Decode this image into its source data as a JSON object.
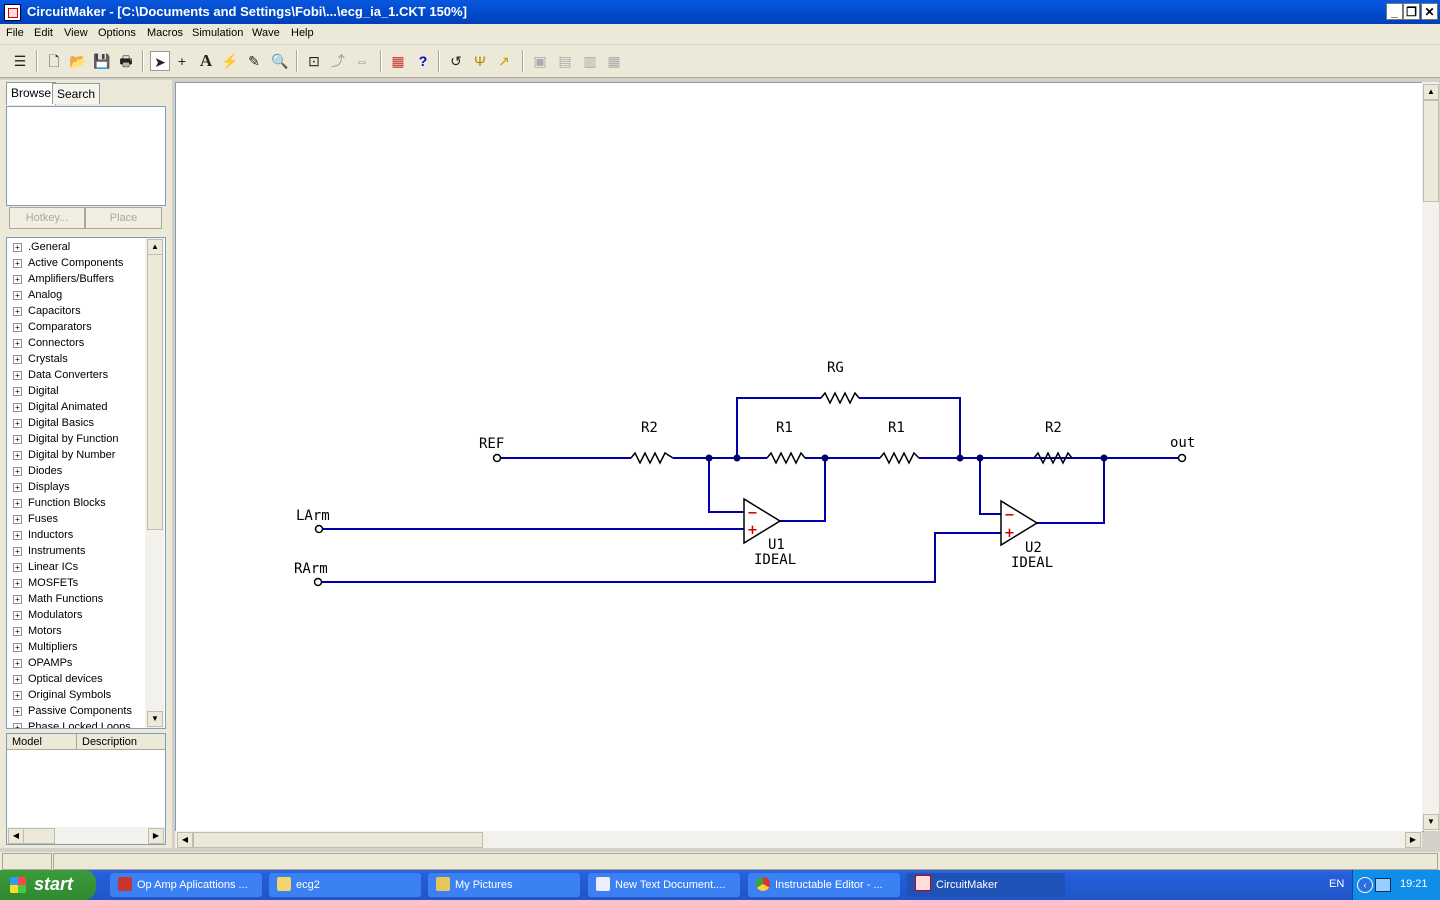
{
  "window": {
    "title": "CircuitMaker - [C:\\Documents and Settings\\Fobi\\...\\ecg_ia_1.CKT 150%]",
    "controls": [
      "_",
      "❐",
      "✕"
    ]
  },
  "menu": [
    "File",
    "Edit",
    "View",
    "Options",
    "Macros",
    "Simulation",
    "Wave",
    "Help"
  ],
  "left_panel": {
    "tabs": [
      "Browse",
      "Search"
    ],
    "hotkey_label": "Hotkey...",
    "place_label": "Place",
    "libraries": [
      ".General",
      "Active Components",
      "Amplifiers/Buffers",
      "Analog",
      "Capacitors",
      "Comparators",
      "Connectors",
      "Crystals",
      "Data Converters",
      "Digital",
      "Digital Animated",
      "Digital Basics",
      "Digital by Function",
      "Digital by Number",
      "Diodes",
      "Displays",
      "Function Blocks",
      "Fuses",
      "Inductors",
      "Instruments",
      "Linear ICs",
      "MOSFETs",
      "Math Functions",
      "Modulators",
      "Motors",
      "Multipliers",
      "OPAMPs",
      "Optical devices",
      "Original Symbols",
      "Passive Components",
      "Phase Locked Loops"
    ],
    "model_columns": [
      "Model",
      "Description"
    ]
  },
  "schematic": {
    "labels": {
      "rg": "RG",
      "r2_left": "R2",
      "r1_left": "R1",
      "r1_right": "R1",
      "r2_right": "R2",
      "ref": "REF",
      "out": "out",
      "larm": "LArm",
      "rarm": "RArm",
      "u1": "U1",
      "u1_model": "IDEAL",
      "u2": "U2",
      "u2_model": "IDEAL",
      "minus": "−",
      "plus": "+"
    },
    "colors": {
      "wire": "#0000aa",
      "component": "#000000",
      "polarity": "#cc0000"
    }
  },
  "taskbar": {
    "start_label": "start",
    "tasks": [
      "Op Amp Aplicattions ...",
      "ecg2",
      "My Pictures",
      "New Text Document....",
      "Instructable Editor - ...",
      "CircuitMaker"
    ],
    "language": "EN",
    "clock": "19:21"
  }
}
